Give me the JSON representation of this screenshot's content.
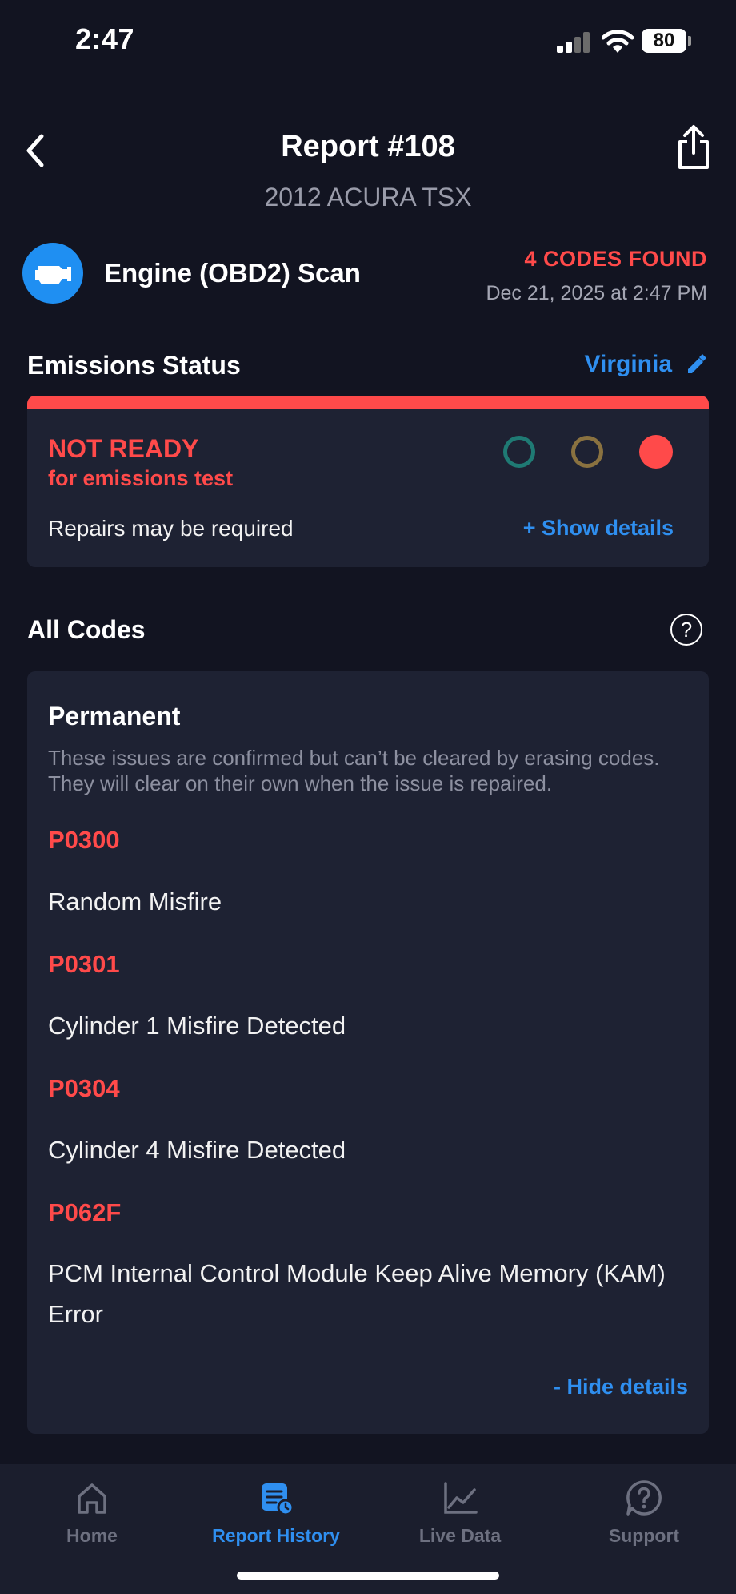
{
  "status_bar": {
    "time": "2:47",
    "battery": "80"
  },
  "header": {
    "title": "Report #108",
    "vehicle": "2012 ACURA TSX"
  },
  "scan": {
    "type": "Engine (OBD2) Scan",
    "codes_found": "4 CODES FOUND",
    "date": "Dec 21, 2025 at 2:47 PM"
  },
  "emissions": {
    "section_title": "Emissions Status",
    "state": "Virginia",
    "status": "NOT READY",
    "status_sub": "for emissions test",
    "note": "Repairs may be required",
    "details_link": "+ Show details",
    "colors": {
      "green": "#1f7a74",
      "yellow": "#8a7240",
      "red": "#ff4a4a"
    }
  },
  "codes": {
    "section_title": "All Codes",
    "group_title": "Permanent",
    "group_desc": "These issues are confirmed but can’t be cleared by erasing codes. They will clear on their own when the issue is repaired.",
    "items": [
      {
        "code": "P0300",
        "desc": "Random Misfire"
      },
      {
        "code": "P0301",
        "desc": "Cylinder 1 Misfire Detected"
      },
      {
        "code": "P0304",
        "desc": "Cylinder 4 Misfire Detected"
      },
      {
        "code": "P062F",
        "desc": "PCM Internal Control Module Keep Alive Memory (KAM) Error"
      }
    ],
    "hide_link": "- Hide details"
  },
  "tabs": [
    {
      "label": "Home",
      "icon": "home-icon"
    },
    {
      "label": "Report History",
      "icon": "report-history-icon",
      "active": true
    },
    {
      "label": "Live Data",
      "icon": "chart-icon"
    },
    {
      "label": "Support",
      "icon": "help-icon"
    }
  ],
  "accent_color": "#2f8ff0",
  "alert_color": "#ff4a4a"
}
